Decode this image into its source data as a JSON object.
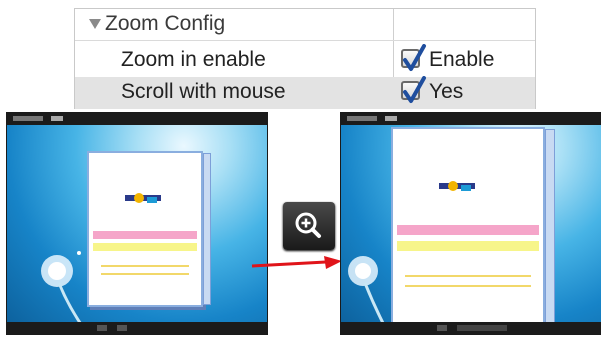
{
  "zoom_config": {
    "header": "Zoom Config",
    "rows": [
      {
        "label": "Zoom in enable",
        "value": "Enable",
        "checked": true
      },
      {
        "label": "Scroll with mouse",
        "value": "Yes",
        "checked": true
      }
    ]
  },
  "icons": {
    "collapse": "triangle-down-icon",
    "zoom": "zoom-in-icon",
    "arrow": "arrow-right-icon"
  },
  "colors": {
    "arrow": "#e0141a",
    "checkmark": "#1f4e9e",
    "row_highlight": "#e3e3e3"
  }
}
